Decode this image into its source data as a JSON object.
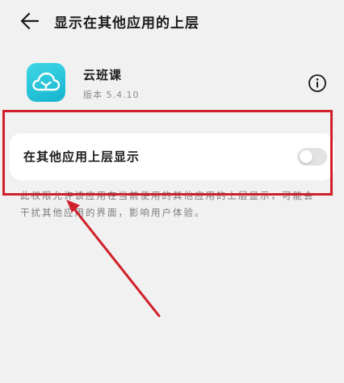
{
  "header": {
    "title": "显示在其他应用的上层",
    "back_icon": "back-arrow-icon"
  },
  "app": {
    "name": "云班课",
    "version": "版本 5.4.10",
    "icon": "cloud-class-app-icon",
    "icon_color": "#1fc3d9",
    "info_icon": "info-icon"
  },
  "setting": {
    "label": "在其他应用上层显示",
    "enabled": false
  },
  "description": "此权限允许该应用在当前使用的其他应用的上层显示，可能会干扰其他应用的界面，影响用户体验。",
  "annotation": {
    "color": "#d0202a",
    "box": "highlight-box",
    "arrow": "pointer-arrow"
  }
}
